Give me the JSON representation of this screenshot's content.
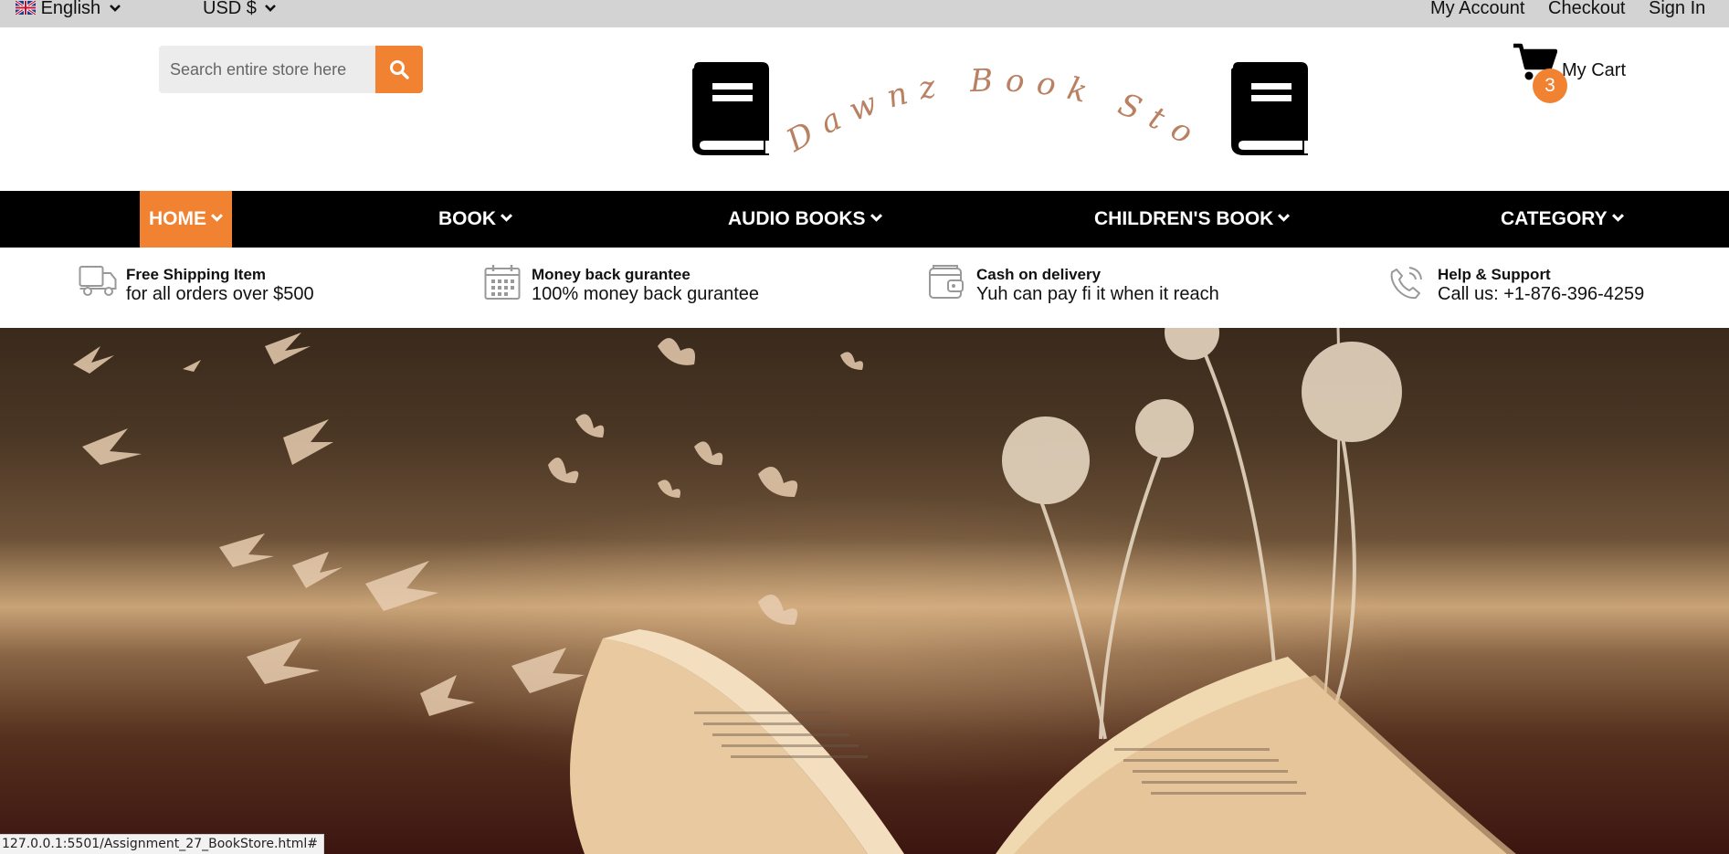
{
  "topbar": {
    "language": "English",
    "currency": "USD $",
    "links": [
      "My Account",
      "Checkout",
      "Sign In"
    ]
  },
  "header": {
    "search_placeholder": "Search entire store here",
    "logo_text": "Dawnz Book Store",
    "cart_label": "My Cart",
    "cart_count": "3"
  },
  "nav": {
    "items": [
      "HOME",
      "BOOK",
      "AUDIO BOOKS",
      "CHILDREN'S BOOK",
      "CATEGORY"
    ],
    "active": "HOME"
  },
  "features": [
    {
      "icon": "truck-icon",
      "title": "Free Shipping Item",
      "subtitle": "for all orders over $500"
    },
    {
      "icon": "calendar-icon",
      "title": "Money back gurantee",
      "subtitle": "100% money back gurantee"
    },
    {
      "icon": "wallet-icon",
      "title": "Cash on delivery",
      "subtitle": "Yuh can pay fi it when it reach"
    },
    {
      "icon": "phone-icon",
      "title": "Help & Support",
      "subtitle": "Call us: +1-876-396-4259"
    }
  ],
  "status_bar": {
    "url": "127.0.0.1:5501/Assignment_27_BookStore.html#"
  },
  "colors": {
    "accent": "#f08232",
    "nav_bg": "#000000",
    "topbar_bg": "#d3d3d3",
    "logo_text": "#b98062"
  }
}
